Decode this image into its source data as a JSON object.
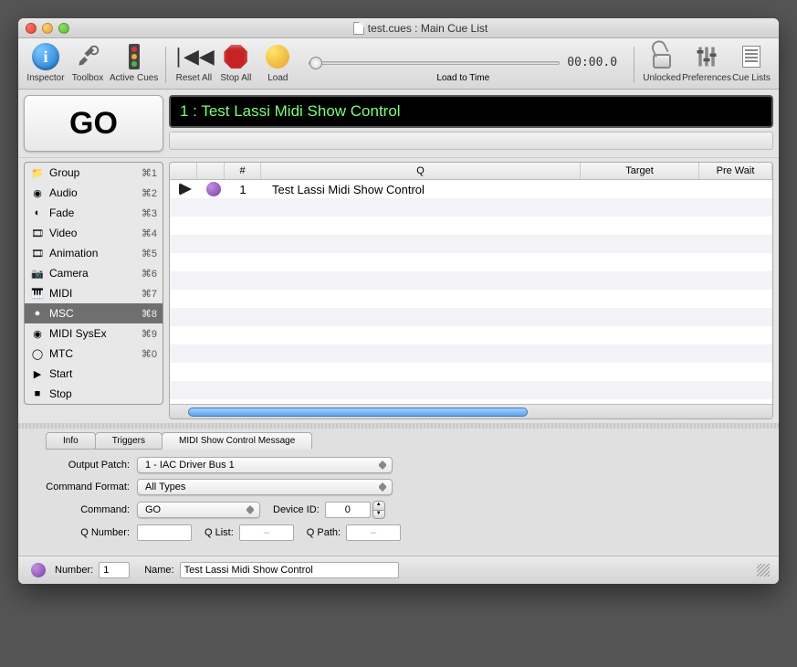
{
  "window": {
    "title": "test.cues : Main Cue List"
  },
  "toolbar": {
    "inspector": "Inspector",
    "toolbox": "Toolbox",
    "active_cues": "Active Cues",
    "reset_all": "Reset All",
    "stop_all": "Stop All",
    "load": "Load",
    "load_to_time": "Load to Time",
    "time": "00:00.0",
    "unlocked": "Unlocked",
    "preferences": "Preferences",
    "cue_lists": "Cue Lists"
  },
  "go_button": "GO",
  "current_cue": "1 : Test Lassi Midi Show Control",
  "sidebar": {
    "items": [
      {
        "label": "Group",
        "cmd": "⌘1",
        "icon": "📁"
      },
      {
        "label": "Audio",
        "cmd": "⌘2",
        "icon": "◉"
      },
      {
        "label": "Fade",
        "cmd": "⌘3",
        "icon": "◐"
      },
      {
        "label": "Video",
        "cmd": "⌘4",
        "icon": "🎞"
      },
      {
        "label": "Animation",
        "cmd": "⌘5",
        "icon": "🎞"
      },
      {
        "label": "Camera",
        "cmd": "⌘6",
        "icon": "📷"
      },
      {
        "label": "MIDI",
        "cmd": "⌘7",
        "icon": "🎹"
      },
      {
        "label": "MSC",
        "cmd": "⌘8",
        "icon": "●",
        "selected": true
      },
      {
        "label": "MIDI SysEx",
        "cmd": "⌘9",
        "icon": "◉"
      },
      {
        "label": "MTC",
        "cmd": "⌘0",
        "icon": "◯"
      },
      {
        "label": "Start",
        "cmd": "",
        "icon": "▶"
      },
      {
        "label": "Stop",
        "cmd": "",
        "icon": "■"
      }
    ]
  },
  "cue_table": {
    "headers": {
      "num": "#",
      "q": "Q",
      "target": "Target",
      "pre_wait": "Pre Wait"
    },
    "rows": [
      {
        "num": "1",
        "q": "Test Lassi Midi Show Control",
        "target": "",
        "pre_wait": ""
      }
    ]
  },
  "inspector": {
    "tabs": {
      "info": "Info",
      "triggers": "Triggers",
      "msc": "MIDI Show Control Message"
    },
    "output_patch_label": "Output Patch:",
    "output_patch": "1 - IAC Driver Bus 1",
    "command_format_label": "Command Format:",
    "command_format": "All Types",
    "command_label": "Command:",
    "command": "GO",
    "device_id_label": "Device ID:",
    "device_id": "0",
    "q_number_label": "Q Number:",
    "q_number": "",
    "q_list_label": "Q List:",
    "q_list": "–",
    "q_path_label": "Q Path:",
    "q_path": "–"
  },
  "footer": {
    "number_label": "Number:",
    "number": "1",
    "name_label": "Name:",
    "name": "Test Lassi Midi Show Control"
  }
}
